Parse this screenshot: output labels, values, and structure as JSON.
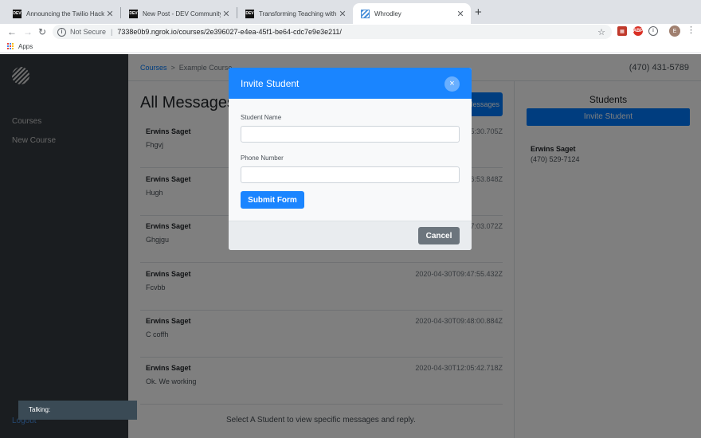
{
  "browser": {
    "tabs": [
      {
        "title": "Announcing the Twilio Hackath",
        "favicon": "dev-icon"
      },
      {
        "title": "New Post - DEV Community 🦄",
        "favicon": "dev-icon"
      },
      {
        "title": "Transforming Teaching with Te",
        "favicon": "dev-icon"
      },
      {
        "title": "Whrodley",
        "favicon": "whrodley-icon",
        "active": true
      }
    ],
    "security_text": "Not Secure",
    "url": "7338e0b9.ngrok.io/courses/2e396027-e4ea-45f1-be64-cdc7e9e3e211/",
    "bookmarks": [
      "Apps"
    ],
    "profile_initial": "E"
  },
  "sidebar": {
    "items": [
      "Courses",
      "New Course"
    ],
    "logout_label": "Logout"
  },
  "breadcrumb": [
    "Courses",
    "Example Course"
  ],
  "header_phone": "(470) 431-5789",
  "main": {
    "title": "All Messages",
    "all_messages_button": "Messages",
    "messages": [
      {
        "name": "Erwins Saget",
        "text": "Fhgvj",
        "time": "2020-04-30T09:45:30.705Z"
      },
      {
        "name": "Erwins Saget",
        "text": "Hugh",
        "time": "2020-04-30T09:46:53.848Z"
      },
      {
        "name": "Erwins Saget",
        "text": "Ghgjgu",
        "time": "2020-04-30T09:47:03.072Z"
      },
      {
        "name": "Erwins Saget",
        "text": "Fcvbb",
        "time": "2020-04-30T09:47:55.432Z"
      },
      {
        "name": "Erwins Saget",
        "text": "C coffh",
        "time": "2020-04-30T09:48:00.884Z"
      },
      {
        "name": "Erwins Saget",
        "text": "Ok. We working",
        "time": "2020-04-30T12:05:42.718Z"
      }
    ],
    "select_hint": "Select A Student to view specific messages and reply."
  },
  "students": {
    "title": "Students",
    "invite_button": "Invite Student",
    "list": [
      {
        "name": "Erwins Saget",
        "phone": "(470) 529-7124"
      }
    ]
  },
  "toast": "Talking:",
  "modal": {
    "title": "Invite Student",
    "close_glyph": "×",
    "student_name_label": "Student Name",
    "student_name_value": "",
    "phone_label": "Phone Number",
    "phone_value": "",
    "submit_label": "Submit Form",
    "cancel_label": "Cancel"
  },
  "colors": {
    "primary": "#007bff",
    "modal_header": "#1a85ff",
    "sidebar_bg": "#343a40",
    "secondary": "#6c757d"
  }
}
